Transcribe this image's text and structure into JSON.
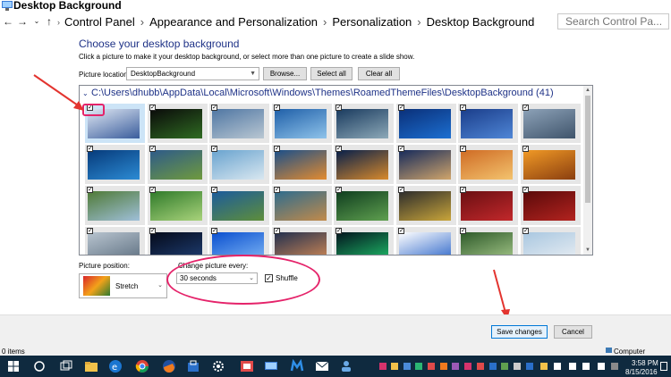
{
  "window": {
    "title": "Desktop Background"
  },
  "address": {
    "crumbs": [
      "Control Panel",
      "Appearance and Personalization",
      "Personalization",
      "Desktop Background"
    ],
    "search_placeholder": "Search Control Pa..."
  },
  "content": {
    "heading": "Choose your desktop background",
    "subtext": "Click a picture to make it your desktop background, or select more than one picture to create a slide show.",
    "location_label": "Picture location:",
    "location_value": "DesktopBackground",
    "browse_label": "Browse...",
    "select_all_label": "Select all",
    "clear_all_label": "Clear all",
    "path": "C:\\Users\\dhubb\\AppData\\Local\\Microsoft\\Windows\\Themes\\RoamedThemeFiles\\DesktopBackground (41)"
  },
  "thumbnails": {
    "rows": [
      [
        {
          "checked": true,
          "colors": [
            "#dfe7f3",
            "#3a5d9c"
          ],
          "selected": true
        },
        {
          "checked": true,
          "colors": [
            "#0a0a0a",
            "#2f6b22"
          ]
        },
        {
          "checked": true,
          "colors": [
            "#4f76a3",
            "#b9c7d2"
          ]
        },
        {
          "checked": true,
          "colors": [
            "#1f5fa8",
            "#8fc3ea"
          ]
        },
        {
          "checked": true,
          "colors": [
            "#193a5e",
            "#8da9b8"
          ]
        },
        {
          "checked": true,
          "colors": [
            "#0a2f78",
            "#1c6fd1"
          ]
        },
        {
          "checked": true,
          "colors": [
            "#1a3d8a",
            "#4f86d6"
          ]
        },
        {
          "checked": true,
          "colors": [
            "#8da2b8",
            "#3f546b"
          ]
        }
      ],
      [
        {
          "checked": true,
          "colors": [
            "#063a7a",
            "#2c8bd4"
          ]
        },
        {
          "checked": true,
          "colors": [
            "#2d5a8a",
            "#6f9a3d"
          ]
        },
        {
          "checked": true,
          "colors": [
            "#69a3cf",
            "#d9e7f0"
          ]
        },
        {
          "checked": true,
          "colors": [
            "#1a4f8a",
            "#e38b2f"
          ]
        },
        {
          "checked": true,
          "colors": [
            "#061f4a",
            "#d88a2c"
          ]
        },
        {
          "checked": true,
          "colors": [
            "#152a5b",
            "#d0a56b"
          ]
        },
        {
          "checked": true,
          "colors": [
            "#cf6b24",
            "#f3c36e"
          ]
        },
        {
          "checked": true,
          "colors": [
            "#f19a26",
            "#8a3e0f"
          ]
        }
      ],
      [
        {
          "checked": true,
          "colors": [
            "#4f7a36",
            "#9fbfd9"
          ]
        },
        {
          "checked": true,
          "colors": [
            "#2f7a2a",
            "#a9d37b"
          ]
        },
        {
          "checked": true,
          "colors": [
            "#1c5b9c",
            "#5e8e3a"
          ]
        },
        {
          "checked": true,
          "colors": [
            "#2e6c8e",
            "#c28a4a"
          ]
        },
        {
          "checked": true,
          "colors": [
            "#0f3d1f",
            "#5fa04f"
          ]
        },
        {
          "checked": true,
          "colors": [
            "#2c2c2c",
            "#c9a53a"
          ]
        },
        {
          "checked": true,
          "colors": [
            "#6a0f12",
            "#c2282b"
          ]
        },
        {
          "checked": true,
          "colors": [
            "#5a0a0a",
            "#b3231f"
          ]
        }
      ],
      [
        {
          "checked": true,
          "colors": [
            "#b8c4cf",
            "#5d6f80"
          ]
        },
        {
          "checked": true,
          "colors": [
            "#050a1a",
            "#1f3f75"
          ]
        },
        {
          "checked": true,
          "colors": [
            "#0a4fcf",
            "#7fb7f5"
          ]
        },
        {
          "checked": true,
          "colors": [
            "#22304f",
            "#d48a55"
          ]
        },
        {
          "checked": true,
          "colors": [
            "#03141e",
            "#1fbf6a"
          ]
        },
        {
          "checked": true,
          "colors": [
            "#ffffff",
            "#2a64c8"
          ]
        },
        {
          "checked": true,
          "colors": [
            "#2e5a2a",
            "#a6c88a"
          ]
        },
        {
          "checked": true,
          "colors": [
            "#a9c7e0",
            "#e9eef3"
          ]
        }
      ]
    ]
  },
  "bottom": {
    "position_label": "Picture position:",
    "position_value": "Stretch",
    "change_label": "Change picture every:",
    "change_value": "30 seconds",
    "shuffle_label": "Shuffle",
    "shuffle_checked": true,
    "save_label": "Save changes",
    "cancel_label": "Cancel"
  },
  "status": {
    "items": "0 items",
    "computer": "Computer"
  },
  "taskbar": {
    "time": "3:58 PM",
    "date": "8/15/2016"
  },
  "colors": {
    "highlight": "#e5236a",
    "accent": "#1e3287",
    "taskbar": "#0f2a3f"
  }
}
